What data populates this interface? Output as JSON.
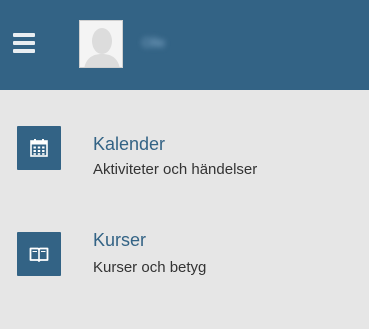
{
  "header": {
    "menu_icon": "hamburger-menu-icon",
    "avatar_icon": "user-avatar-placeholder-icon",
    "username": "Olle",
    "background": "#336385"
  },
  "menu": [
    {
      "title": "Kalender",
      "subtitle": "Aktiviteter och händelser",
      "icon": "calendar-icon"
    },
    {
      "title": "Kurser",
      "subtitle": "Kurser och betyg",
      "icon": "open-book-icon"
    }
  ],
  "colors": {
    "accent": "#336385",
    "background": "#e6e6e6",
    "text": "#333333"
  }
}
